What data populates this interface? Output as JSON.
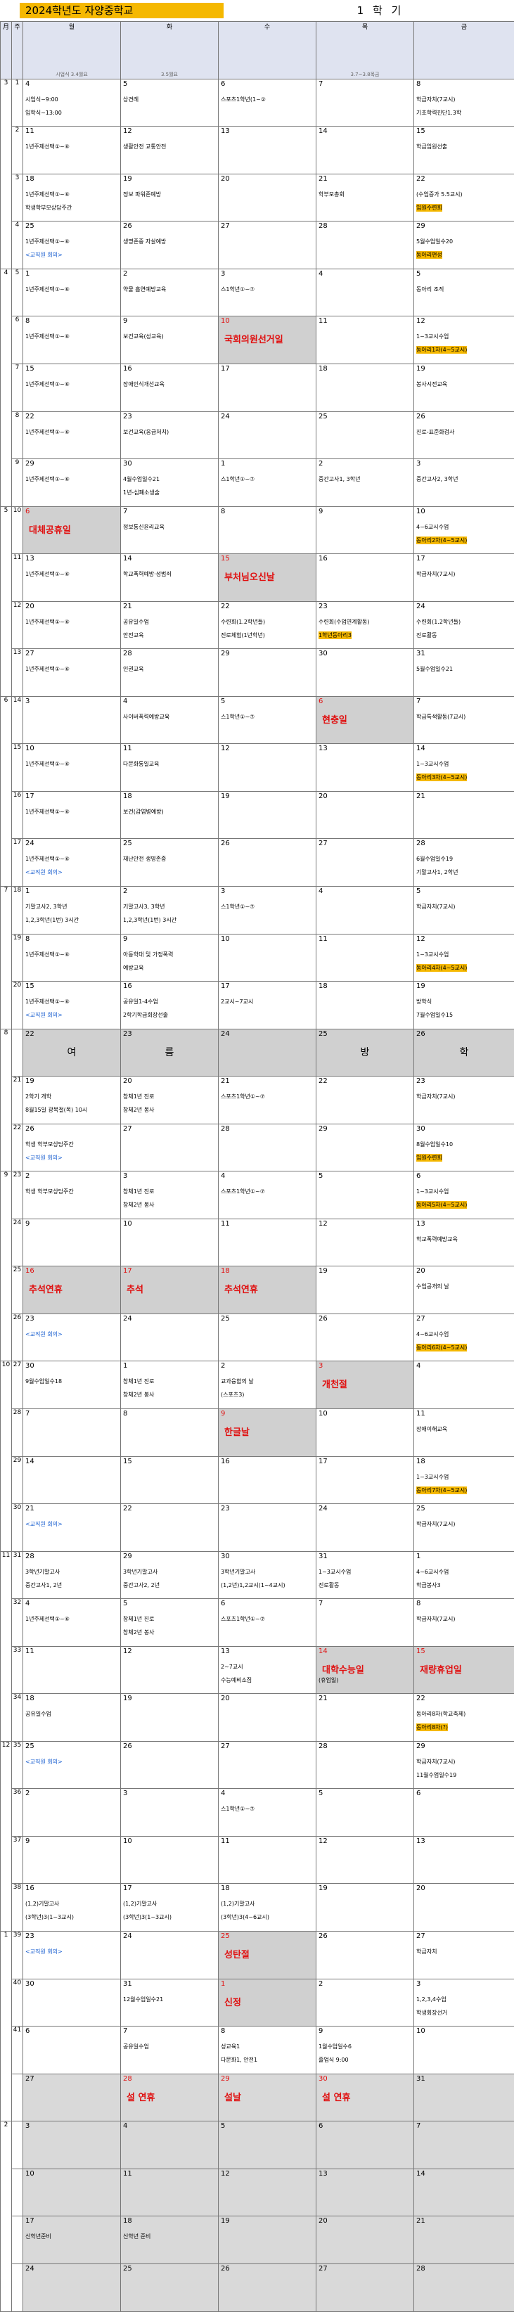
{
  "title": "2024학년도 자양중학교",
  "semester": "1 학 기",
  "headers": {
    "month": "月",
    "week": "주",
    "days": [
      "월",
      "화",
      "수",
      "목",
      "금"
    ],
    "subs": [
      "시업식 3.4월요",
      "3.5월요",
      "",
      "3.7~3.8목금",
      ""
    ]
  },
  "months": [
    "3",
    "4",
    "5",
    "6",
    "7",
    "8",
    "9",
    "10",
    "11",
    "12",
    "1",
    "2"
  ],
  "summer": [
    "여",
    "름",
    "",
    "방",
    "학"
  ],
  "rows": [
    {
      "w": "1",
      "d": [
        [
          "4",
          "시업식~9:00",
          "입학식~13:00"
        ],
        [
          "5",
          "상견례",
          ""
        ],
        [
          "6",
          "스포츠1학년(1~②",
          ""
        ],
        [
          "7",
          "",
          ""
        ],
        [
          "8",
          "학급자치(7교시)",
          "기초학력진단1.3학"
        ]
      ]
    },
    {
      "w": "2",
      "d": [
        [
          "11",
          "1년주제선택①~⑥",
          ""
        ],
        [
          "12",
          "생활안전 교통안전",
          ""
        ],
        [
          "13",
          "",
          ""
        ],
        [
          "14",
          "",
          ""
        ],
        [
          "15",
          "학급임원선출",
          ""
        ]
      ]
    },
    {
      "w": "3",
      "d": [
        [
          "18",
          "1년주제선택①~⑥",
          "학생학부모상담주간"
        ],
        [
          "19",
          "정보 파워존예방",
          ""
        ],
        [
          "20",
          "",
          ""
        ],
        [
          "21",
          "학부모총회",
          ""
        ],
        [
          "22",
          "(수업증가 5.5교시)",
          "임원수련회"
        ]
      ]
    },
    {
      "w": "4",
      "d": [
        [
          "25",
          "1년주제선택①~⑥",
          "<교직원 회의>"
        ],
        [
          "26",
          "생명존중 자살예방",
          ""
        ],
        [
          "27",
          "",
          ""
        ],
        [
          "28",
          "",
          ""
        ],
        [
          "29",
          "5월수업일수20",
          "동아리편성"
        ]
      ]
    },
    {
      "w": "5",
      "d": [
        [
          "1",
          "1년주제선택①~⑥",
          ""
        ],
        [
          "2",
          "약물 흡연예방교육",
          ""
        ],
        [
          "3",
          "스1학년①~⑦",
          ""
        ],
        [
          "4",
          "",
          ""
        ],
        [
          "5",
          "동아리 조직",
          ""
        ]
      ]
    },
    {
      "w": "6",
      "d": [
        [
          "8",
          "1년주제선택①~⑥",
          ""
        ],
        [
          "9",
          "보건교육(성교육)",
          ""
        ],
        [
          "10",
          "국회의원선거일",
          ""
        ],
        [
          "11",
          "",
          ""
        ],
        [
          "12",
          "1~3교시수업",
          "동아리1차(4~5교시)"
        ]
      ]
    },
    {
      "w": "7",
      "d": [
        [
          "15",
          "1년주제선택①~⑥",
          ""
        ],
        [
          "16",
          "장애인식개선교육",
          ""
        ],
        [
          "17",
          "",
          ""
        ],
        [
          "18",
          "",
          ""
        ],
        [
          "19",
          "봉사시전교육",
          ""
        ]
      ]
    },
    {
      "w": "8",
      "d": [
        [
          "22",
          "1년주제선택①~⑥",
          ""
        ],
        [
          "23",
          "보건교육(응급처치)",
          ""
        ],
        [
          "24",
          "",
          ""
        ],
        [
          "25",
          "",
          ""
        ],
        [
          "26",
          "진로-표준화검사",
          ""
        ]
      ]
    },
    {
      "w": "9",
      "d": [
        [
          "29",
          "1년주제선택①~⑥",
          ""
        ],
        [
          "30",
          "4월수업일수21",
          "1년-심폐소생술"
        ],
        [
          "1",
          "스1학년①~⑦",
          ""
        ],
        [
          "2",
          "중간고사1, 3학년",
          ""
        ],
        [
          "3",
          "중간고사2, 3학년",
          ""
        ]
      ]
    },
    {
      "w": "10",
      "d": [
        [
          "6",
          "대체공휴일",
          ""
        ],
        [
          "7",
          "정보통신윤리교육",
          ""
        ],
        [
          "8",
          "",
          ""
        ],
        [
          "9",
          "",
          ""
        ],
        [
          "10",
          "4~6교시수업",
          "동아리2차(4~5교시)"
        ]
      ]
    },
    {
      "w": "11",
      "d": [
        [
          "13",
          "1년주제선택①~⑥",
          ""
        ],
        [
          "14",
          "학교폭력예방·성범죄",
          ""
        ],
        [
          "15",
          "부처님오신날",
          ""
        ],
        [
          "16",
          "",
          ""
        ],
        [
          "17",
          "학급자치(7교시)",
          ""
        ]
      ]
    },
    {
      "w": "12",
      "d": [
        [
          "20",
          "1년주제선택①~⑥",
          ""
        ],
        [
          "21",
          "공유일수업",
          "안전교육"
        ],
        [
          "22",
          "수련회(1.2학년들)",
          "진로체험(1년학년)"
        ],
        [
          "23",
          "수련회(수업연계활동)",
          "1학년동아리3"
        ],
        [
          "24",
          "수련회(1.2학년들)",
          "진로활동"
        ]
      ]
    },
    {
      "w": "13",
      "d": [
        [
          "27",
          "1년주제선택①~⑥",
          ""
        ],
        [
          "28",
          "인권교육",
          ""
        ],
        [
          "29",
          "",
          ""
        ],
        [
          "30",
          "",
          ""
        ],
        [
          "31",
          "5월수업일수21",
          ""
        ]
      ]
    },
    {
      "w": "14",
      "d": [
        [
          "3",
          "",
          ""
        ],
        [
          "4",
          "사이버폭력예방교육",
          ""
        ],
        [
          "5",
          "스1학년①~⑦",
          ""
        ],
        [
          "6",
          "현충일",
          ""
        ],
        [
          "7",
          "학급특색활동(7교시)",
          ""
        ]
      ]
    },
    {
      "w": "15",
      "d": [
        [
          "10",
          "1년주제선택①~⑥",
          ""
        ],
        [
          "11",
          "다문화통일교육",
          ""
        ],
        [
          "12",
          "",
          ""
        ],
        [
          "13",
          "",
          ""
        ],
        [
          "14",
          "1~3교시수업",
          "동아리3차(4~5교시)"
        ]
      ]
    },
    {
      "w": "16",
      "d": [
        [
          "17",
          "1년주제선택①~⑥",
          ""
        ],
        [
          "18",
          "보건(감염병예방)",
          ""
        ],
        [
          "19",
          "",
          ""
        ],
        [
          "20",
          "",
          ""
        ],
        [
          "21",
          "",
          ""
        ]
      ]
    },
    {
      "w": "17",
      "d": [
        [
          "24",
          "1년주제선택①~⑥",
          "<교직원 회의>"
        ],
        [
          "25",
          "재난안전 생명존중",
          ""
        ],
        [
          "26",
          "",
          ""
        ],
        [
          "27",
          "",
          ""
        ],
        [
          "28",
          "6월수업일수19",
          "기말고사1, 2학년"
        ]
      ]
    },
    {
      "w": "18",
      "d": [
        [
          "1",
          "기말고사2, 3학년",
          "1,2,3학년(1번) 3시간"
        ],
        [
          "2",
          "기말고사3, 3학년",
          "1,2,3학년(1번) 3시간"
        ],
        [
          "3",
          "스1학년①~⑦",
          ""
        ],
        [
          "4",
          "",
          ""
        ],
        [
          "5",
          "학급자치(7교시)",
          ""
        ]
      ]
    },
    {
      "w": "19",
      "d": [
        [
          "8",
          "1년주제선택①~⑥",
          ""
        ],
        [
          "9",
          "아동학대 및 가정폭력",
          "예방교육"
        ],
        [
          "10",
          "",
          ""
        ],
        [
          "11",
          "",
          ""
        ],
        [
          "12",
          "1~3교시수업",
          "동아리4차(4~5교시)"
        ]
      ]
    },
    {
      "w": "20",
      "d": [
        [
          "15",
          "1년주제선택①~⑥",
          "<교직원 회의>"
        ],
        [
          "16",
          "공유일1-4수업",
          "2학기학급회장선출"
        ],
        [
          "17",
          "2교시~7교시",
          ""
        ],
        [
          "18",
          "",
          ""
        ],
        [
          "19",
          "방학식",
          "7월수업일수15"
        ]
      ]
    },
    {
      "w": "",
      "d": [
        [
          "22",
          "",
          ""
        ],
        [
          "23",
          "",
          ""
        ],
        [
          "24",
          "",
          ""
        ],
        [
          "25",
          "",
          ""
        ],
        [
          "26",
          "",
          ""
        ]
      ]
    },
    {
      "w": "21",
      "d": [
        [
          "19",
          "2학기 개학",
          "8월15일 광복절(목) 10시"
        ],
        [
          "20",
          "창체1년 진로",
          "창체2년 봉사"
        ],
        [
          "21",
          "스포츠1학년①~⑦",
          ""
        ],
        [
          "22",
          "",
          ""
        ],
        [
          "23",
          "학급자치(7교시)",
          ""
        ]
      ]
    },
    {
      "w": "22",
      "d": [
        [
          "26",
          "학생 학부모상담주간",
          "<교직원 회의>"
        ],
        [
          "27",
          "",
          ""
        ],
        [
          "28",
          "",
          ""
        ],
        [
          "29",
          "",
          ""
        ],
        [
          "30",
          "8월수업일수10",
          "임원수련회"
        ]
      ]
    },
    {
      "w": "23",
      "d": [
        [
          "2",
          "학생 학부모상담주간",
          ""
        ],
        [
          "3",
          "창체1년 진로",
          "창체2년 봉사"
        ],
        [
          "4",
          "스포츠1학년①~⑦",
          ""
        ],
        [
          "5",
          "",
          ""
        ],
        [
          "6",
          "1~3교시수업",
          "동아리5차(4~5교시)"
        ]
      ]
    },
    {
      "w": "24",
      "d": [
        [
          "9",
          "",
          ""
        ],
        [
          "10",
          "",
          ""
        ],
        [
          "11",
          "",
          ""
        ],
        [
          "12",
          "",
          ""
        ],
        [
          "13",
          "학교폭력예방교육",
          ""
        ]
      ]
    },
    {
      "w": "25",
      "d": [
        [
          "16",
          "추석연휴",
          ""
        ],
        [
          "17",
          "추석",
          ""
        ],
        [
          "18",
          "추석연휴",
          ""
        ],
        [
          "19",
          "",
          ""
        ],
        [
          "20",
          "수업공개의 날",
          ""
        ]
      ]
    },
    {
      "w": "26",
      "d": [
        [
          "23",
          "<교직원 회의>",
          ""
        ],
        [
          "24",
          "",
          ""
        ],
        [
          "25",
          "",
          ""
        ],
        [
          "26",
          "",
          ""
        ],
        [
          "27",
          "4~6교시수업",
          "동아리6차(4~5교시)"
        ]
      ]
    },
    {
      "w": "27",
      "d": [
        [
          "30",
          "9월수업일수18",
          ""
        ],
        [
          "1",
          "창체1년 진로",
          "창체2년 봉사"
        ],
        [
          "2",
          "교과융합의 날",
          "(스포츠3)"
        ],
        [
          "3",
          "개천절",
          ""
        ],
        [
          "4",
          "",
          ""
        ]
      ]
    },
    {
      "w": "28",
      "d": [
        [
          "7",
          "",
          ""
        ],
        [
          "8",
          "",
          ""
        ],
        [
          "9",
          "한글날",
          ""
        ],
        [
          "10",
          "",
          ""
        ],
        [
          "11",
          "장애이해교육",
          ""
        ]
      ]
    },
    {
      "w": "29",
      "d": [
        [
          "14",
          "",
          ""
        ],
        [
          "15",
          "",
          ""
        ],
        [
          "16",
          "",
          ""
        ],
        [
          "17",
          "",
          ""
        ],
        [
          "18",
          "1~3교시수업",
          "동아리7차(4~5교시)"
        ]
      ]
    },
    {
      "w": "30",
      "d": [
        [
          "21",
          "<교직원 회의>",
          ""
        ],
        [
          "22",
          "",
          ""
        ],
        [
          "23",
          "",
          ""
        ],
        [
          "24",
          "",
          ""
        ],
        [
          "25",
          "학급자치(7교시)",
          ""
        ]
      ]
    },
    {
      "w": "31",
      "d": [
        [
          "28",
          "3학년기말고사",
          "중간고사1, 2년"
        ],
        [
          "29",
          "3학년기말고사",
          "중간고사2, 2년"
        ],
        [
          "30",
          "3학년기말고사",
          "(1,2년)1,2교시(1~4교시)"
        ],
        [
          "31",
          "1~3교시수업",
          "진로활동"
        ],
        [
          "1",
          "4~6교시수업",
          "학급봉사3"
        ]
      ]
    },
    {
      "w": "32",
      "d": [
        [
          "4",
          "1년주제선택①~⑥",
          ""
        ],
        [
          "5",
          "창체1년 진로",
          "창체2년 봉사"
        ],
        [
          "6",
          "스포츠1학년①~⑦",
          ""
        ],
        [
          "7",
          "",
          ""
        ],
        [
          "8",
          "학급자치(7교시)",
          ""
        ]
      ]
    },
    {
      "w": "33",
      "d": [
        [
          "11",
          "",
          ""
        ],
        [
          "12",
          "",
          ""
        ],
        [
          "13",
          "2~7교시",
          "수능예비소집"
        ],
        [
          "14",
          "대학수능일",
          "(휴업일)"
        ],
        [
          "15",
          "재량휴업일",
          ""
        ]
      ]
    },
    {
      "w": "34",
      "d": [
        [
          "18",
          "공유일수업",
          ""
        ],
        [
          "19",
          "",
          ""
        ],
        [
          "20",
          "",
          ""
        ],
        [
          "21",
          "",
          ""
        ],
        [
          "22",
          "동아리8차(학교축제)",
          "동아리8차(?)"
        ]
      ]
    },
    {
      "w": "35",
      "d": [
        [
          "25",
          "<교직원 회의>",
          ""
        ],
        [
          "26",
          "",
          ""
        ],
        [
          "27",
          "",
          ""
        ],
        [
          "28",
          "",
          ""
        ],
        [
          "29",
          "학급자치(7교시)",
          "11월수업일수19"
        ]
      ]
    },
    {
      "w": "36",
      "d": [
        [
          "2",
          "",
          ""
        ],
        [
          "3",
          "",
          ""
        ],
        [
          "4",
          "스1학년①~⑦",
          ""
        ],
        [
          "5",
          "",
          ""
        ],
        [
          "6",
          "",
          ""
        ]
      ]
    },
    {
      "w": "37",
      "d": [
        [
          "9",
          "",
          ""
        ],
        [
          "10",
          "",
          ""
        ],
        [
          "11",
          "",
          ""
        ],
        [
          "12",
          "",
          ""
        ],
        [
          "13",
          "",
          ""
        ]
      ]
    },
    {
      "w": "38",
      "d": [
        [
          "16",
          "(1,2)기말고사",
          "(3학년)3(1~3교시)"
        ],
        [
          "17",
          "(1,2)기말고사",
          "(3학년)3(1~3교시)"
        ],
        [
          "18",
          "(1,2)기말고사",
          "(3학년)3(4~6교시)"
        ],
        [
          "19",
          "",
          ""
        ],
        [
          "20",
          "",
          ""
        ]
      ]
    },
    {
      "w": "39",
      "d": [
        [
          "23",
          "<교직원 회의>",
          ""
        ],
        [
          "24",
          "",
          ""
        ],
        [
          "25",
          "성탄절",
          ""
        ],
        [
          "26",
          "",
          ""
        ],
        [
          "27",
          "학급자치",
          ""
        ]
      ]
    },
    {
      "w": "40",
      "d": [
        [
          "30",
          "",
          ""
        ],
        [
          "31",
          "12월수업일수21",
          ""
        ],
        [
          "1",
          "신정",
          ""
        ],
        [
          "2",
          "",
          ""
        ],
        [
          "3",
          "1,2,3,4수업",
          "학생회장선거"
        ]
      ]
    },
    {
      "w": "41",
      "d": [
        [
          "6",
          "",
          ""
        ],
        [
          "7",
          "공유일수업",
          ""
        ],
        [
          "8",
          "성교육1",
          "다문화1, 안전1"
        ],
        [
          "9",
          "1월수업일수6",
          "졸업식 9:00"
        ],
        [
          "10",
          "",
          ""
        ]
      ]
    },
    {
      "w": "",
      "d": [
        [
          "27",
          "",
          ""
        ],
        [
          "28",
          "설 연휴",
          ""
        ],
        [
          "29",
          "설날",
          ""
        ],
        [
          "30",
          "설 연휴",
          ""
        ],
        [
          "31",
          "",
          ""
        ]
      ]
    },
    {
      "w": "",
      "d": [
        [
          "3",
          "",
          ""
        ],
        [
          "4",
          "",
          ""
        ],
        [
          "5",
          "",
          ""
        ],
        [
          "6",
          "",
          ""
        ],
        [
          "7",
          "",
          ""
        ]
      ]
    },
    {
      "w": "",
      "d": [
        [
          "10",
          "",
          ""
        ],
        [
          "11",
          "",
          ""
        ],
        [
          "12",
          "",
          ""
        ],
        [
          "13",
          "",
          ""
        ],
        [
          "14",
          "",
          ""
        ]
      ]
    },
    {
      "w": "",
      "d": [
        [
          "17",
          "신학년준비",
          ""
        ],
        [
          "18",
          "신학년 준비",
          ""
        ],
        [
          "19",
          "",
          ""
        ],
        [
          "20",
          "",
          ""
        ],
        [
          "21",
          "",
          ""
        ]
      ]
    },
    {
      "w": "",
      "d": [
        [
          "24",
          "",
          ""
        ],
        [
          "25",
          "",
          ""
        ],
        [
          "26",
          "",
          ""
        ],
        [
          "27",
          "",
          ""
        ],
        [
          "28",
          "",
          ""
        ]
      ]
    }
  ]
}
